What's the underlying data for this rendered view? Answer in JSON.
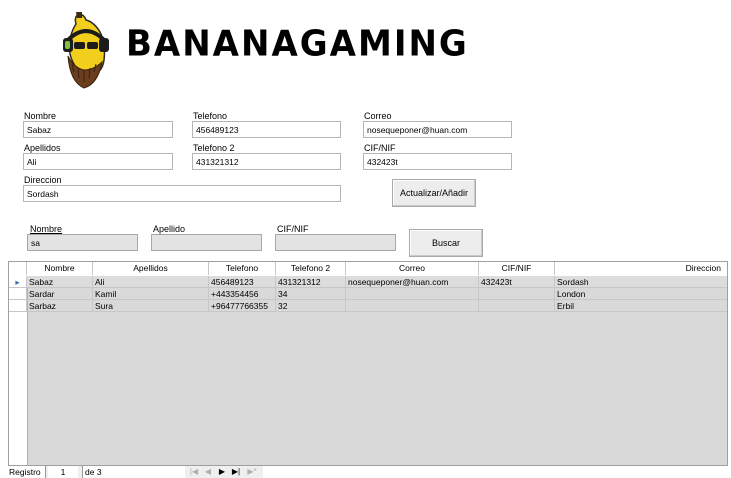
{
  "logo": {
    "text": "BANANAGAMING",
    "icon": "banana-mascot-icon"
  },
  "form": {
    "nombre_label": "Nombre",
    "nombre_value": "Sabaz",
    "telefono_label": "Telefono",
    "telefono_value": "456489123",
    "correo_label": "Correo",
    "correo_value": "nosequeponer@huan.com",
    "apellidos_label": "Apellidos",
    "apellidos_value": "Ali",
    "telefono2_label": "Telefono 2",
    "telefono2_value": "431321312",
    "cif_label": "CIF/NIF",
    "cif_value": "432423t",
    "direccion_label": "Direccion",
    "direccion_value": "Sordash",
    "update_button": "Actualizar/Añadir"
  },
  "search": {
    "nombre_label": "Nombre",
    "nombre_value": "sa",
    "apellido_label": "Apellido",
    "apellido_value": "",
    "cif_label": "CIF/NIF",
    "cif_value": "",
    "search_button": "Buscar"
  },
  "table": {
    "columns": [
      "Nombre",
      "Apellidos",
      "Telefono",
      "Telefono 2",
      "Correo",
      "CIF/NIF",
      "Direccion"
    ],
    "rows": [
      [
        "Sabaz",
        "Ali",
        "456489123",
        "431321312",
        "nosequeponer@huan.com",
        "432423t",
        "Sordash"
      ],
      [
        "Sardar",
        "Kamil",
        "+443354456",
        "34",
        "",
        "",
        "London"
      ],
      [
        "Sarbaz",
        "Sura",
        "+96477766355",
        "32",
        "",
        "",
        "Erbil"
      ]
    ]
  },
  "nav": {
    "registro_label": "Registro",
    "current": "1",
    "of_label": "de 3"
  }
}
